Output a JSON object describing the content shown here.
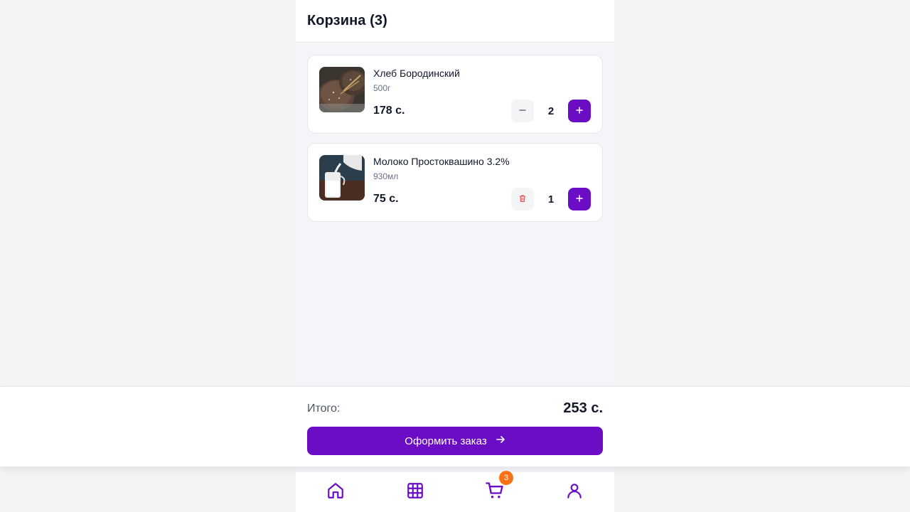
{
  "header": {
    "title": "Корзина (3)"
  },
  "cart": {
    "items": [
      {
        "name": "Хлеб Бородинский",
        "weight": "500г",
        "price": "178 с.",
        "quantity": "2",
        "decrement_icon": "minus-icon"
      },
      {
        "name": "Молоко Простоквашино 3.2%",
        "weight": "930мл",
        "price": "75 с.",
        "quantity": "1",
        "decrement_icon": "trash-icon"
      }
    ]
  },
  "summary": {
    "total_label": "Итого:",
    "total_value": "253 с.",
    "checkout_label": "Оформить заказ"
  },
  "nav": {
    "items": [
      "home-icon",
      "catalog-grid-icon",
      "cart-icon",
      "profile-icon"
    ],
    "cart_badge": "3"
  },
  "colors": {
    "accent": "#6a0dc4",
    "badge": "#f97316",
    "delete_icon": "#ef4444"
  }
}
